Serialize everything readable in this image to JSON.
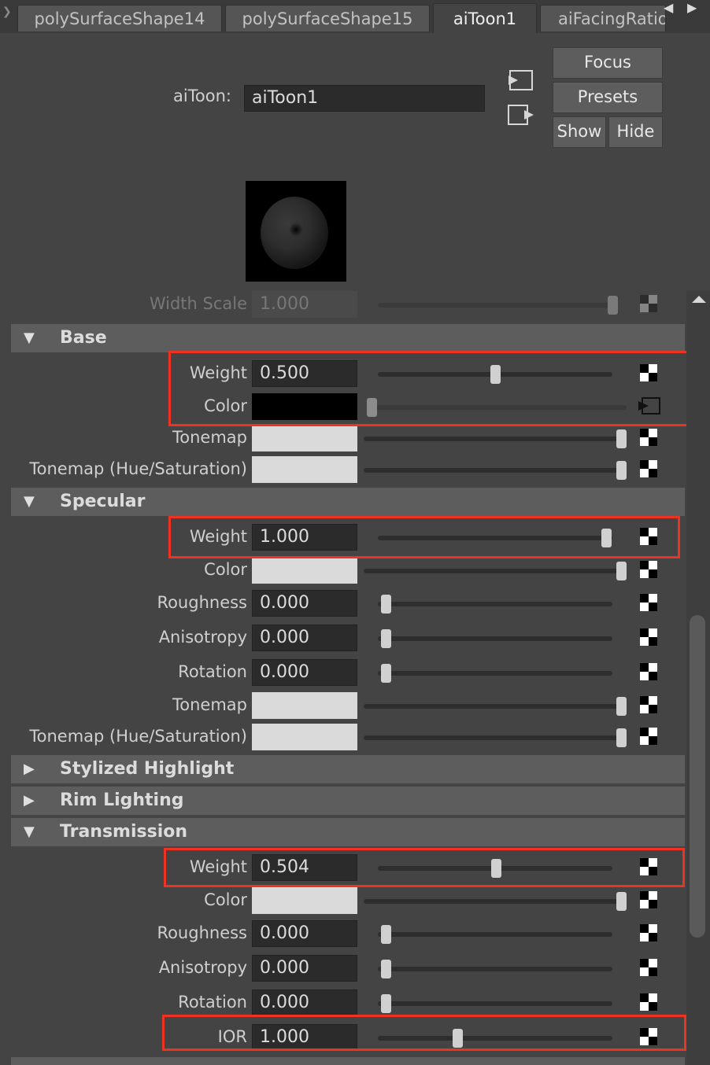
{
  "tabs": [
    {
      "label": "polySurfaceShape14",
      "active": false
    },
    {
      "label": "polySurfaceShape15",
      "active": false
    },
    {
      "label": "aiToon1",
      "active": true
    },
    {
      "label": "aiFacingRatio",
      "active": false
    }
  ],
  "tab_nav": {
    "left_icon": "triangle-left-icon",
    "right_icon": "triangle-right-icon"
  },
  "header": {
    "node_label": "aiToon:",
    "node_name": "aiToon1",
    "focus_label": "Focus",
    "presets_label": "Presets",
    "show_label": "Show",
    "hide_label": "Hide"
  },
  "rows": {
    "width_scale": {
      "label": "Width Scale",
      "value": "1.000",
      "slider": 1.0
    },
    "base_weight": {
      "label": "Weight",
      "value": "0.500",
      "slider": 0.5
    },
    "base_color": {
      "label": "Color",
      "value": "",
      "slider": 0.0
    },
    "base_tonemap": {
      "label": "Tonemap",
      "value": "",
      "slider": 1.0
    },
    "base_tonemap_hs": {
      "label": "Tonemap (Hue/Saturation)",
      "value": "",
      "slider": 1.0
    },
    "spec_weight": {
      "label": "Weight",
      "value": "1.000",
      "slider": 1.0
    },
    "spec_color": {
      "label": "Color",
      "value": "",
      "slider": 1.0
    },
    "spec_roughness": {
      "label": "Roughness",
      "value": "0.000",
      "slider": 0.0
    },
    "spec_anisotropy": {
      "label": "Anisotropy",
      "value": "0.000",
      "slider": 0.0
    },
    "spec_rotation": {
      "label": "Rotation",
      "value": "0.000",
      "slider": 0.0
    },
    "spec_tonemap": {
      "label": "Tonemap",
      "value": "",
      "slider": 1.0
    },
    "spec_tonemap_hs": {
      "label": "Tonemap (Hue/Saturation)",
      "value": "",
      "slider": 1.0
    },
    "trans_weight": {
      "label": "Weight",
      "value": "0.504",
      "slider": 0.504
    },
    "trans_color": {
      "label": "Color",
      "value": "",
      "slider": 1.0
    },
    "trans_roughness": {
      "label": "Roughness",
      "value": "0.000",
      "slider": 0.0
    },
    "trans_anisotropy": {
      "label": "Anisotropy",
      "value": "0.000",
      "slider": 0.0
    },
    "trans_rotation": {
      "label": "Rotation",
      "value": "0.000",
      "slider": 0.0
    },
    "trans_ior": {
      "label": "IOR",
      "value": "1.000",
      "slider": 0.34
    }
  },
  "sections": {
    "base": {
      "title": "Base",
      "expanded": true
    },
    "specular": {
      "title": "Specular",
      "expanded": true
    },
    "stylized": {
      "title": "Stylized Highlight",
      "expanded": false
    },
    "rim": {
      "title": "Rim Lighting",
      "expanded": false
    },
    "transmission": {
      "title": "Transmission",
      "expanded": true
    }
  },
  "colors": {
    "highlight_box": "#ee3322",
    "panel_bg": "#444444",
    "section_bg": "#5d5d5d"
  }
}
